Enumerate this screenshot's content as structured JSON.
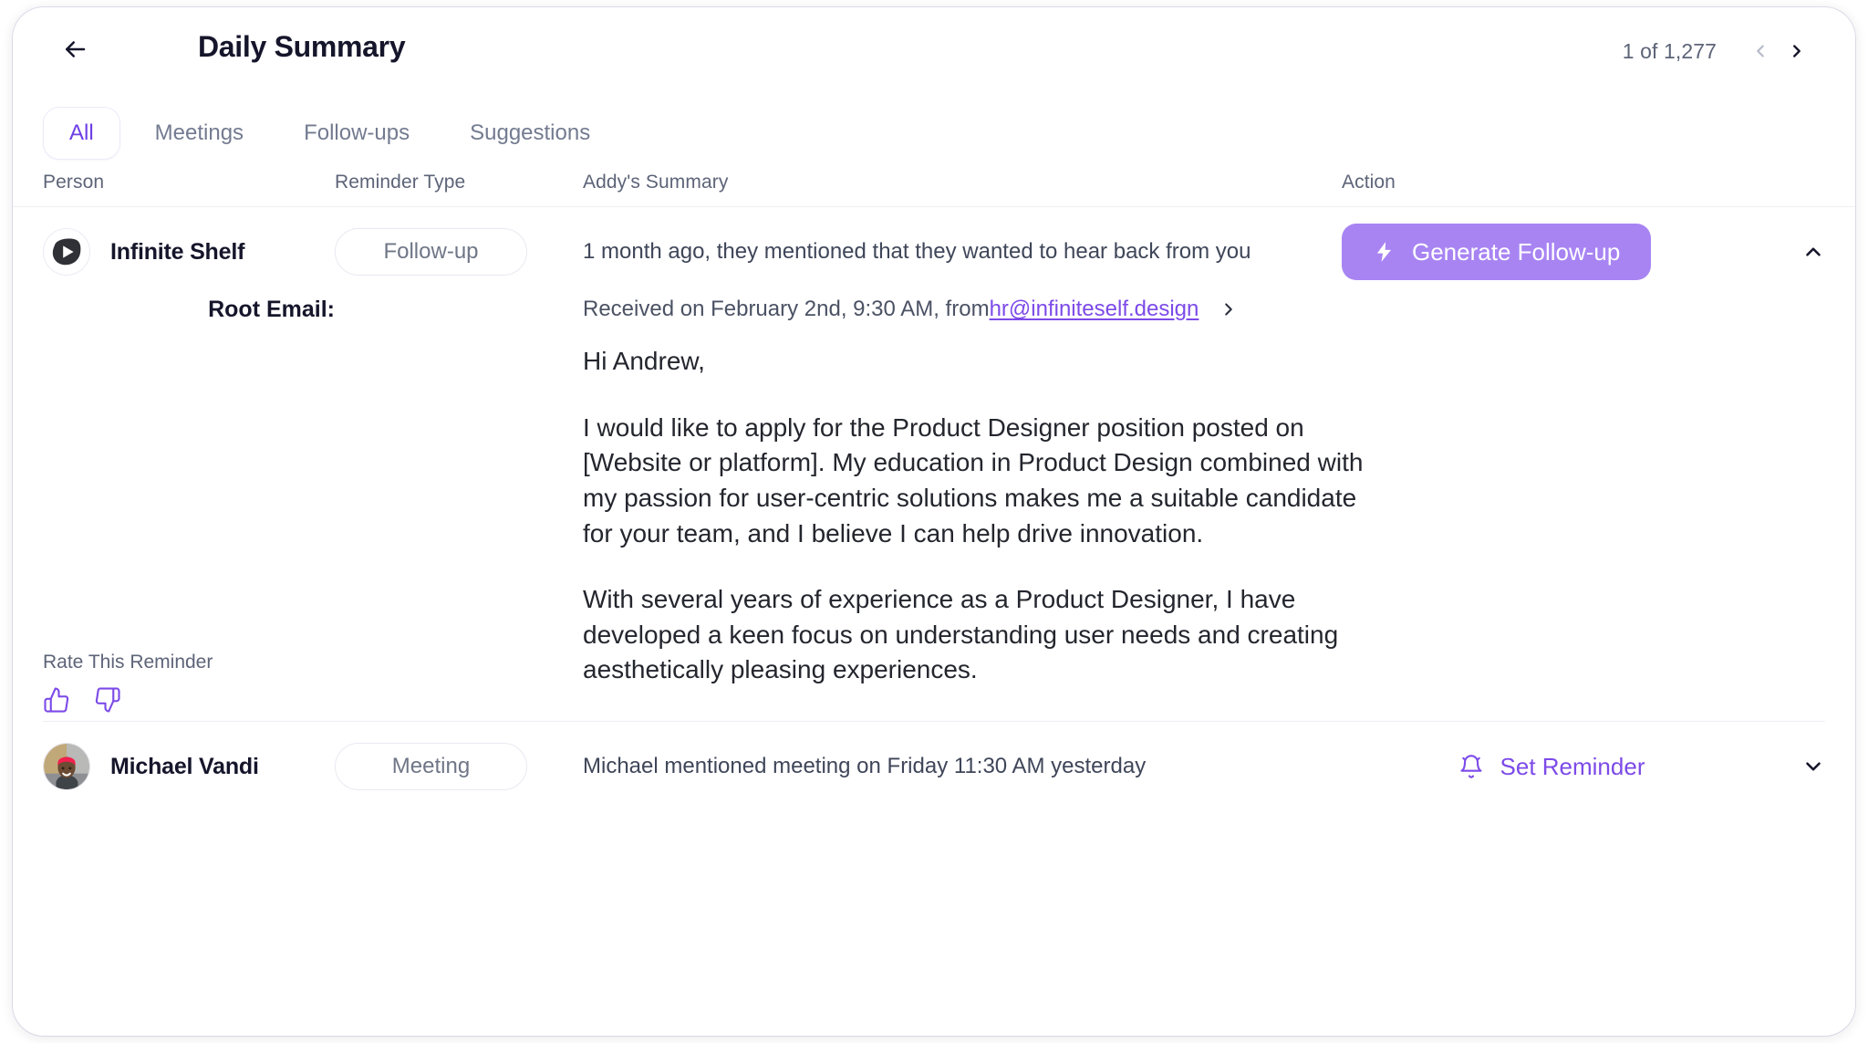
{
  "header": {
    "back_icon": "arrow-left-icon",
    "title": "Daily Summary",
    "pager": {
      "count_label": "1 of 1,277",
      "prev_icon": "chevron-left-icon",
      "next_icon": "chevron-right-icon"
    }
  },
  "tabs": [
    {
      "label": "All",
      "active": true
    },
    {
      "label": "Meetings",
      "active": false
    },
    {
      "label": "Follow-ups",
      "active": false
    },
    {
      "label": "Suggestions",
      "active": false
    }
  ],
  "table": {
    "headers": {
      "person": "Person",
      "type": "Reminder Type",
      "summary": "Addy's Summary",
      "action": "Action"
    },
    "rows": [
      {
        "avatar_name": "infinite-shelf-logo-avatar",
        "person": "Infinite Shelf",
        "reminder_type": "Follow-up",
        "summary": "1 month ago, they mentioned that they wanted to hear back from you",
        "action_label": "Generate Follow-up",
        "action_icon": "lightning-bolt-icon",
        "action_style": "primary",
        "toggle_icon": "chevron-up-icon",
        "expanded": true,
        "detail": {
          "root_email_label": "Root Email:",
          "received_prefix": "Received on February 2nd, 9:30 AM, from ",
          "sender_email": "hr@infiniteself.design",
          "open_icon": "chevron-right-icon",
          "paragraphs": [
            "Hi Andrew,",
            "I would like to apply for the Product Designer position posted on [Website or platform]. My education in Product Design combined with my passion for user-centric solutions makes me a suitable candidate for your team, and I believe I can help drive innovation.",
            "With several years of experience as a Product Designer, I have developed a keen focus on understanding user needs and creating aesthetically pleasing experiences."
          ],
          "rate_label": "Rate This Reminder",
          "thumbs_up_icon": "thumbs-up-icon",
          "thumbs_down_icon": "thumbs-down-icon"
        }
      },
      {
        "avatar_name": "michael-vandi-photo-avatar",
        "person": "Michael Vandi",
        "reminder_type": "Meeting",
        "summary": "Michael mentioned meeting on Friday 11:30 AM yesterday",
        "action_label": "Set Reminder",
        "action_icon": "bell-icon",
        "action_style": "link",
        "toggle_icon": "chevron-down-icon",
        "expanded": false
      }
    ]
  },
  "colors": {
    "accent_purple": "#7c4ae8",
    "button_purple": "#a884f3",
    "text_dark": "#15152b",
    "text_muted": "#5d6478",
    "border": "#eeeef4"
  }
}
